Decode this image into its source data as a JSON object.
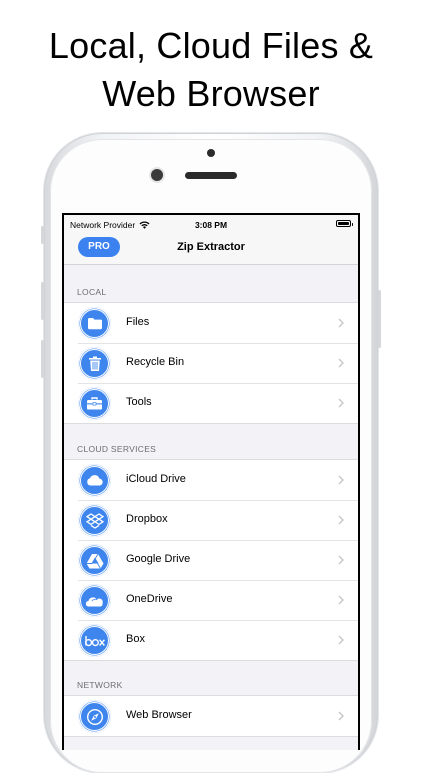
{
  "headline": {
    "line1": "Local, Cloud Files &",
    "line2": "Web Browser"
  },
  "status_bar": {
    "carrier": "Network Provider",
    "time": "3:08 PM",
    "wifi_icon": "wifi-icon",
    "battery_icon": "battery-icon"
  },
  "navbar": {
    "pro_label": "PRO",
    "title": "Zip Extractor"
  },
  "sections": [
    {
      "header": "LOCAL",
      "items": [
        {
          "label": "Files",
          "icon": "folder-icon"
        },
        {
          "label": "Recycle Bin",
          "icon": "trash-icon"
        },
        {
          "label": "Tools",
          "icon": "toolbox-icon"
        }
      ]
    },
    {
      "header": "CLOUD SERVICES",
      "items": [
        {
          "label": "iCloud Drive",
          "icon": "cloud-icon"
        },
        {
          "label": "Dropbox",
          "icon": "dropbox-icon"
        },
        {
          "label": "Google Drive",
          "icon": "google-drive-icon"
        },
        {
          "label": "OneDrive",
          "icon": "onedrive-icon"
        },
        {
          "label": "Box",
          "icon": "box-icon"
        }
      ]
    },
    {
      "header": "NETWORK",
      "items": [
        {
          "label": "Web Browser",
          "icon": "compass-icon"
        }
      ]
    }
  ],
  "colors": {
    "accent": "#3e86ee",
    "pro_button": "#3b82f0",
    "group_bg": "#f2f2f7"
  }
}
